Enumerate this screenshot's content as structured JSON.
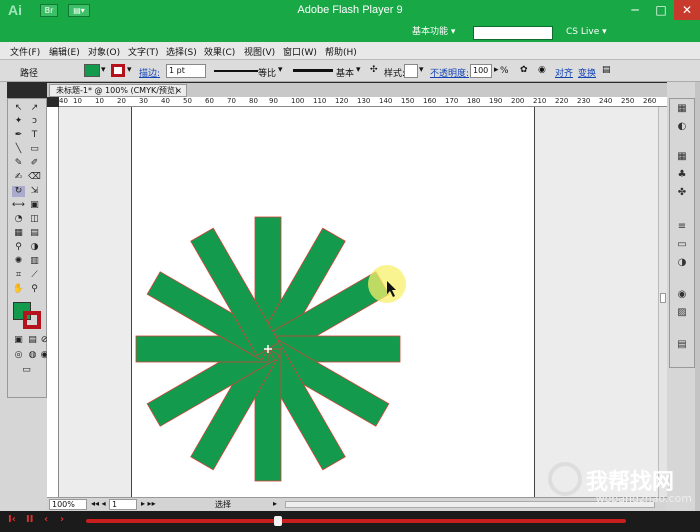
{
  "app": {
    "logo": "Ai",
    "title": "Adobe Flash Player 9"
  },
  "window_controls": {
    "minimize": "─",
    "maximize": "□",
    "close": "✕"
  },
  "top_right": {
    "workspace": "基本功能 ▾",
    "cslive": "CS Live ▾"
  },
  "menu": [
    "文件(F)",
    "编辑(E)",
    "对象(O)",
    "文字(T)",
    "选择(S)",
    "效果(C)",
    "视图(V)",
    "窗口(W)",
    "帮助(H)"
  ],
  "control": {
    "object_type": "路径",
    "fill_color": "#139a4c",
    "stroke_color": "#b5121b",
    "stroke_label": "描边:",
    "stroke_weight": "1 pt",
    "profile": "等比",
    "brush": "基本",
    "style_label": "样式:",
    "opacity_label": "不透明度:",
    "opacity_value": "100",
    "opacity_unit": "%",
    "align": "对齐",
    "transform": "变换"
  },
  "document_tab": {
    "title": "未标题-1* @ 100% (CMYK/预览)",
    "close": "×"
  },
  "ruler": {
    "h_ticks": [
      "40",
      "10",
      "10",
      "20",
      "30",
      "40",
      "50",
      "60",
      "70",
      "80",
      "90",
      "100",
      "110",
      "120",
      "130",
      "140",
      "150",
      "160",
      "170",
      "180",
      "190",
      "200",
      "210",
      "220",
      "230",
      "240",
      "250",
      "260"
    ]
  },
  "status": {
    "zoom": "100%",
    "page": "1",
    "tool": "选择"
  },
  "artwork": {
    "fill": "#139a4c",
    "stroke": "#d0443a",
    "petals": 12,
    "rotation_deg": 30
  },
  "watermark": {
    "text": "我帮找网",
    "url": "wobangzhao.com"
  },
  "tools": [
    "↖",
    "↗",
    "✎",
    "⌂",
    "✒",
    "T",
    "\\",
    "▭",
    "╱",
    "✐",
    "✂",
    "⎋",
    "↻",
    "⇲",
    "⌖",
    "▦",
    "◐",
    "◑",
    "⚲",
    "✋",
    "🔍"
  ]
}
